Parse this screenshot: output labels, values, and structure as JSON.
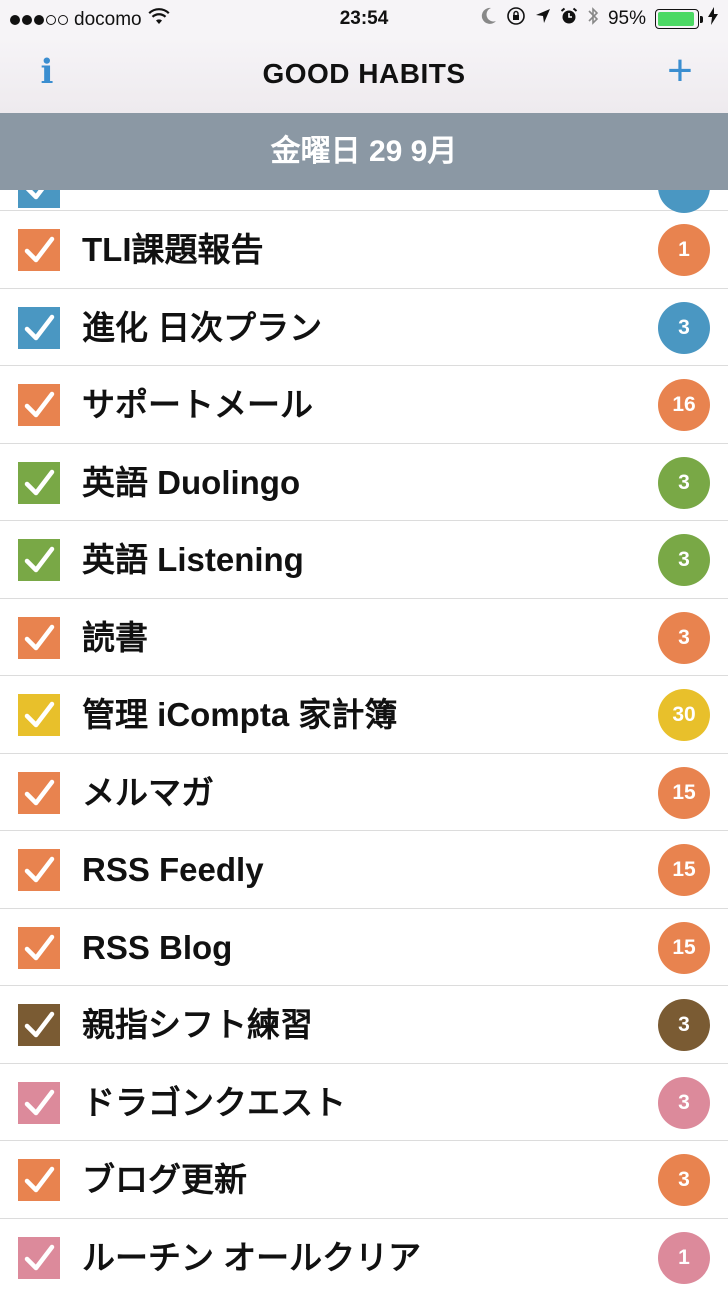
{
  "status_bar": {
    "carrier": "docomo",
    "time": "23:54",
    "battery": "95%",
    "battery_level": 0.95,
    "icons": [
      "wifi-icon",
      "moon-icon",
      "orientation-lock-icon",
      "location-icon",
      "alarm-icon",
      "bluetooth-icon",
      "charging-icon"
    ]
  },
  "nav": {
    "title": "GOOD HABITS",
    "info_label": "i",
    "add_label": "+"
  },
  "date_header": "金曜日 29 9月",
  "colors": {
    "orange": "#e8834f",
    "blue": "#4a97c2",
    "green": "#79a846",
    "yellow": "#e8c02b",
    "brown": "#7a5b33",
    "pink": "#dc8a9b",
    "nav_accent": "#3b8ed0",
    "date_bar": "#8b98a4"
  },
  "habits": [
    {
      "label": "",
      "count": "",
      "color": "#4a97c2",
      "partial": true
    },
    {
      "label": "TLI課題報告",
      "count": "1",
      "color": "#e8834f"
    },
    {
      "label": "進化 日次プラン",
      "count": "3",
      "color": "#4a97c2"
    },
    {
      "label": "サポートメール",
      "count": "16",
      "color": "#e8834f"
    },
    {
      "label": "英語 Duolingo",
      "count": "3",
      "color": "#79a846"
    },
    {
      "label": "英語 Listening",
      "count": "3",
      "color": "#79a846"
    },
    {
      "label": "読書",
      "count": "3",
      "color": "#e8834f"
    },
    {
      "label": "管理 iCompta 家計簿",
      "count": "30",
      "color": "#e8c02b"
    },
    {
      "label": "メルマガ",
      "count": "15",
      "color": "#e8834f"
    },
    {
      "label": "RSS Feedly",
      "count": "15",
      "color": "#e8834f"
    },
    {
      "label": "RSS Blog",
      "count": "15",
      "color": "#e8834f"
    },
    {
      "label": "親指シフト練習",
      "count": "3",
      "color": "#7a5b33"
    },
    {
      "label": "ドラゴンクエスト",
      "count": "3",
      "color": "#dc8a9b"
    },
    {
      "label": "ブログ更新",
      "count": "3",
      "color": "#e8834f"
    },
    {
      "label": "ルーチン オールクリア",
      "count": "1",
      "color": "#dc8a9b"
    }
  ]
}
